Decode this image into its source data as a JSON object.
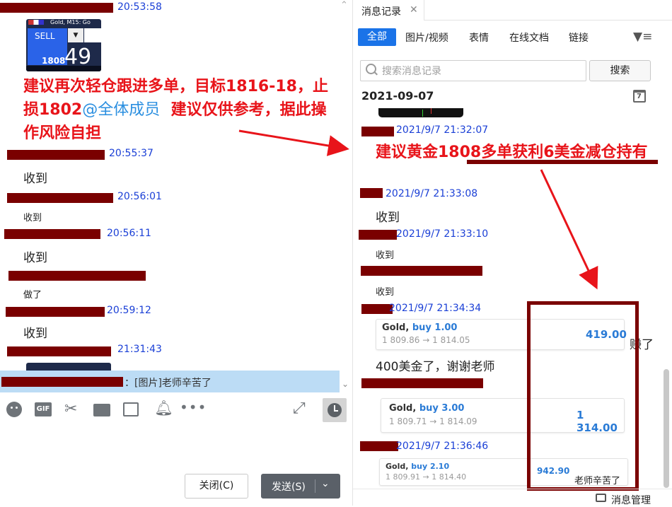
{
  "left": {
    "messages": [
      {
        "time": "20:53:58"
      },
      {
        "time": "20:55:37",
        "text": "收到"
      },
      {
        "time": "20:56:01",
        "text": "收到"
      },
      {
        "time": "20:56:11",
        "text": "收到"
      },
      {
        "text": "做了"
      },
      {
        "time": "20:59:12",
        "text": "收到"
      },
      {
        "time": "21:31:43"
      }
    ],
    "widget": {
      "sell_label": "SELL",
      "symbol": "Gold, M15: Go",
      "price_big": "49",
      "price_small": "1808"
    },
    "advice_part1": "建议再次轻仓跟进多单，目标1816-18，止损1802",
    "mention": "@全体成员",
    "advice_part2": "建议仅供参考，据此操作风险自担",
    "reply_bar_text": "：[图片]老师辛苦了",
    "close_button": "关闭(C)",
    "send_button": "发送(S)",
    "toolbar_gif": "GIF"
  },
  "right": {
    "panel_title": "消息记录",
    "tabs": [
      "全部",
      "图片/视频",
      "表情",
      "在线文档",
      "链接"
    ],
    "search_placeholder": "搜索消息记录",
    "search_button": "搜索",
    "date": "2021-09-07",
    "calendar_day": "7",
    "messages": [
      {
        "time": "2021/9/7 21:32:07"
      },
      {
        "time": "2021/9/7 21:33:08",
        "text": "收到"
      },
      {
        "time": "2021/9/7 21:33:10",
        "text": "收到"
      },
      {
        "text": "收到"
      },
      {
        "time": "2021/9/7 21:34:34"
      },
      {
        "text": "400美金了，谢谢老师"
      },
      {
        "time": "2021/9/7 21:36:46"
      }
    ],
    "gold_advice": "建议黄金1808多单获利6美金减仓持有",
    "trades": [
      {
        "symbol": "Gold,",
        "action": "buy 1.00",
        "prices": "1 809.86 → 1 814.05",
        "profit": "419.00"
      },
      {
        "symbol": "Gold,",
        "action": "buy 3.00",
        "prices": "1 809.71 → 1 814.09",
        "profit": "1 314.00"
      },
      {
        "symbol": "Gold,",
        "action": "buy 2.10",
        "prices": "1 809.91 → 1 814.40",
        "profit": "942.90"
      }
    ],
    "earned_text": "赚了",
    "thanks_text": "老师辛苦了",
    "manage_label": "消息管理"
  }
}
